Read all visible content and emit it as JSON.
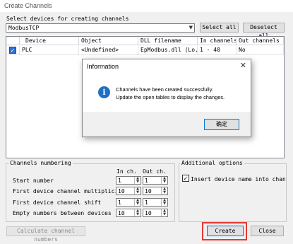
{
  "window": {
    "title": "Create Channels"
  },
  "select": {
    "label": "Select devices for creating channels",
    "protocol": "ModbusTCP",
    "select_all": "Select all",
    "deselect_all": "Deselect all"
  },
  "grid": {
    "headers": [
      "Device",
      "Object",
      "DLL filename",
      "In channels",
      "Out channels"
    ],
    "row": {
      "checked": true,
      "device": "PLC",
      "object": "<Undefined>",
      "dll": "EpModbus.dll (Lo...",
      "in": "1 - 40",
      "out": "No"
    }
  },
  "numbering": {
    "title": "Channels numbering",
    "col_in": "In ch.",
    "col_out": "Out ch.",
    "rows": [
      {
        "label": "Start number",
        "in": "1",
        "out": "1"
      },
      {
        "label": "First device channel multiplicity",
        "in": "10",
        "out": "10"
      },
      {
        "label": "First device channel shift",
        "in": "1",
        "out": "1"
      },
      {
        "label": "Empty numbers between devices",
        "in": "10",
        "out": "10"
      }
    ],
    "calc_button": "Calculate channel numbers"
  },
  "additional": {
    "title": "Additional options",
    "insert_name_label": "Insert device name into channel na",
    "insert_name_checked": true
  },
  "footer": {
    "create": "Create",
    "close": "Close"
  },
  "dialog": {
    "title": "Information",
    "line1": "Channels have been created successfully.",
    "line2": "Update the open tables to display the changes.",
    "ok": "确定"
  }
}
